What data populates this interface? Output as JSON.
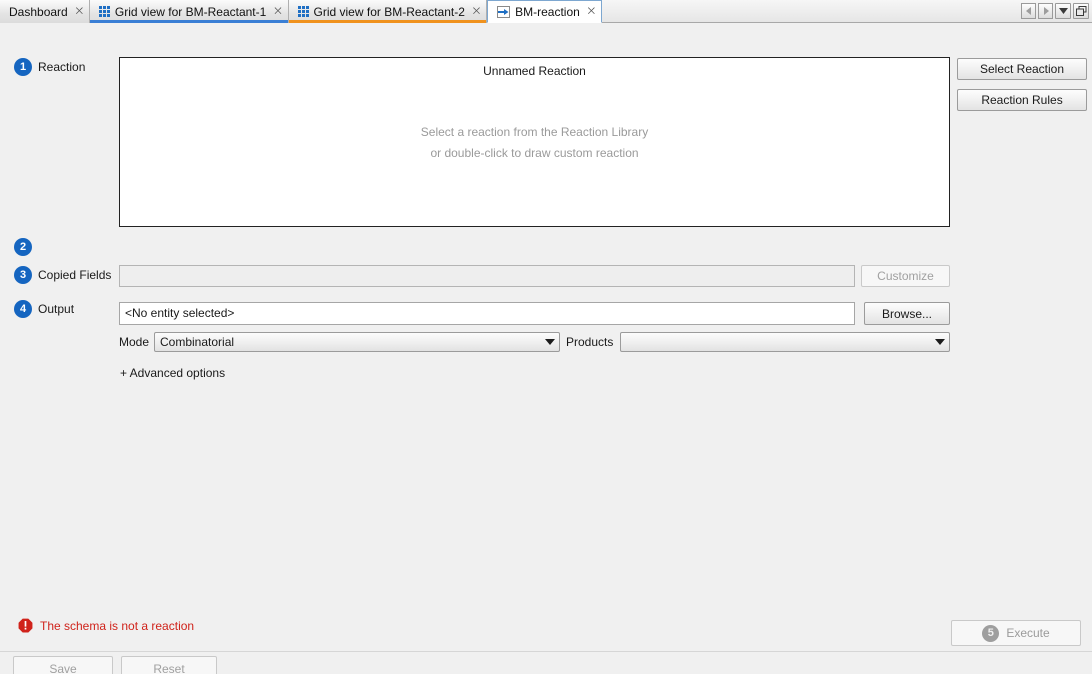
{
  "window": {
    "tabs": [
      {
        "label": "Dashboard",
        "icon": "none",
        "accent": "none",
        "active": false,
        "closable": true
      },
      {
        "label": "Grid view for BM-Reactant-1",
        "icon": "grid-icon",
        "accent": "#3a7fd5",
        "active": false,
        "closable": true
      },
      {
        "label": "Grid view for BM-Reactant-2",
        "icon": "grid-icon",
        "accent": "#f0921e",
        "active": false,
        "closable": true
      },
      {
        "label": "BM-reaction",
        "icon": "reaction-arrow-icon",
        "accent": "none",
        "active": true,
        "closable": true
      }
    ],
    "close_glyph": "⨉",
    "controls": [
      {
        "name": "scroll-tabs-left-button",
        "glyph": "left-triangle"
      },
      {
        "name": "scroll-tabs-right-button",
        "glyph": "right-triangle"
      },
      {
        "name": "tab-list-dropdown-button",
        "glyph": "down-triangle"
      },
      {
        "name": "restore-window-button",
        "glyph": "restore"
      }
    ]
  },
  "steps": [
    {
      "number": "1",
      "label": "Reaction"
    },
    {
      "number": "2",
      "label": ""
    },
    {
      "number": "3",
      "label": "Copied Fields"
    },
    {
      "number": "4",
      "label": "Output"
    }
  ],
  "reaction": {
    "title": "Unnamed Reaction",
    "hint_line_1": "Select a reaction from the Reaction Library",
    "hint_line_2": "or double-click to draw custom reaction",
    "select_reaction_label": "Select Reaction",
    "reaction_rules_label": "Reaction Rules"
  },
  "copied_fields": {
    "value": "",
    "customize_label": "Customize"
  },
  "output": {
    "value": "<No entity selected>",
    "browse_label": "Browse...",
    "mode_label": "Mode",
    "mode_value": "Combinatorial",
    "products_label": "Products",
    "products_value": "",
    "advanced_options_label": "+ Advanced options"
  },
  "status": {
    "error_text": "The schema is not a reaction",
    "error_color": "#d0231b"
  },
  "actions": {
    "execute_badge": "5",
    "execute_label": "Execute",
    "save_label": "Save",
    "reset_label": "Reset"
  }
}
